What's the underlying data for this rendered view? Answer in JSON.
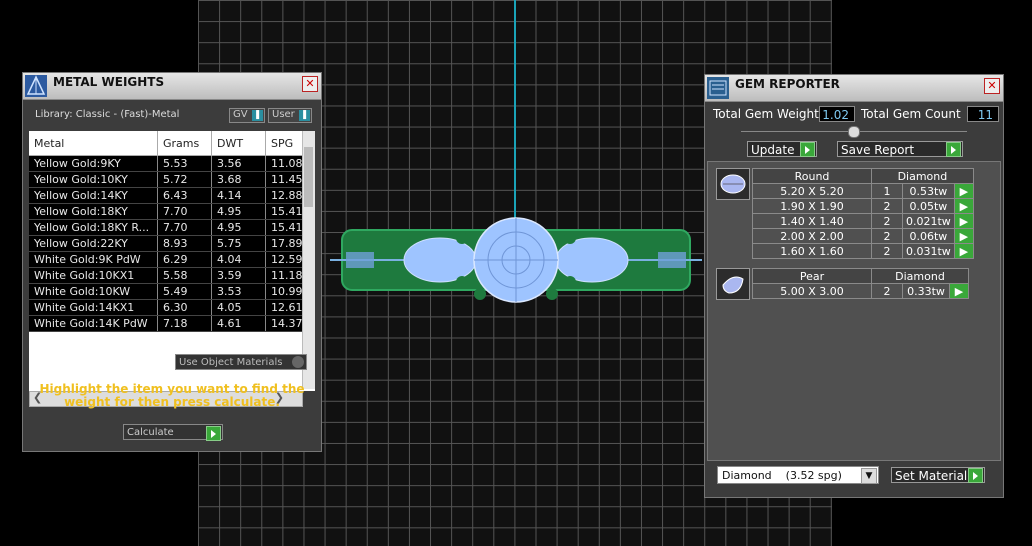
{
  "metal_panel": {
    "title": "METAL WEIGHTS",
    "library": "Library: Classic - (Fast)-Metal",
    "gv_label": "GV",
    "user_label": "User",
    "columns": [
      "Metal",
      "Grams",
      "DWT",
      "SPG"
    ],
    "rows": [
      [
        "Yellow Gold:9KY",
        "5.53",
        "3.56",
        "11.08"
      ],
      [
        "Yellow Gold:10KY",
        "5.72",
        "3.68",
        "11.45"
      ],
      [
        "Yellow Gold:14KY",
        "6.43",
        "4.14",
        "12.88"
      ],
      [
        "Yellow Gold:18KY",
        "7.70",
        "4.95",
        "15.41"
      ],
      [
        "Yellow Gold:18KY R...",
        "7.70",
        "4.95",
        "15.41"
      ],
      [
        "Yellow Gold:22KY",
        "8.93",
        "5.75",
        "17.89"
      ],
      [
        "White Gold:9K PdW",
        "6.29",
        "4.04",
        "12.59"
      ],
      [
        "White Gold:10KX1",
        "5.58",
        "3.59",
        "11.18"
      ],
      [
        "White Gold:10KW",
        "5.49",
        "3.53",
        "10.99"
      ],
      [
        "White Gold:14KX1",
        "6.30",
        "4.05",
        "12.61"
      ],
      [
        "White Gold:14K PdW",
        "7.18",
        "4.61",
        "14.37"
      ]
    ],
    "use_object_materials": "Use Object Materials",
    "hint": "Highlight the item you want to find the weight for then press calculate.",
    "calculate_label": "Calculate"
  },
  "gem_panel": {
    "title": "GEM REPORTER",
    "total_weight_label": "Total Gem Weight",
    "total_weight": "1.02",
    "total_count_label": "Total Gem Count",
    "total_count": "11",
    "update_label": "Update",
    "save_report_label": "Save Report",
    "groups": [
      {
        "shape": "Round",
        "material": "Diamond",
        "rows": [
          [
            "5.20 X 5.20",
            "1",
            "0.53tw"
          ],
          [
            "1.90 X 1.90",
            "2",
            "0.05tw"
          ],
          [
            "1.40 X 1.40",
            "2",
            "0.021tw"
          ],
          [
            "2.00 X 2.00",
            "2",
            "0.06tw"
          ],
          [
            "1.60 X 1.60",
            "2",
            "0.031tw"
          ]
        ]
      },
      {
        "shape": "Pear",
        "material": "Diamond",
        "rows": [
          [
            "5.00 X 3.00",
            "2",
            "0.33tw"
          ]
        ]
      }
    ],
    "material_select": "Diamond    (3.52 spg)",
    "set_material_label": "Set Material"
  },
  "colors": {
    "accent_cyan": "#1aa3b8",
    "hint_yellow": "#f0c020",
    "button_green": "#3aa83a",
    "ring_green": "#1e7a3e",
    "gem_blue": "#9ec4ff"
  }
}
